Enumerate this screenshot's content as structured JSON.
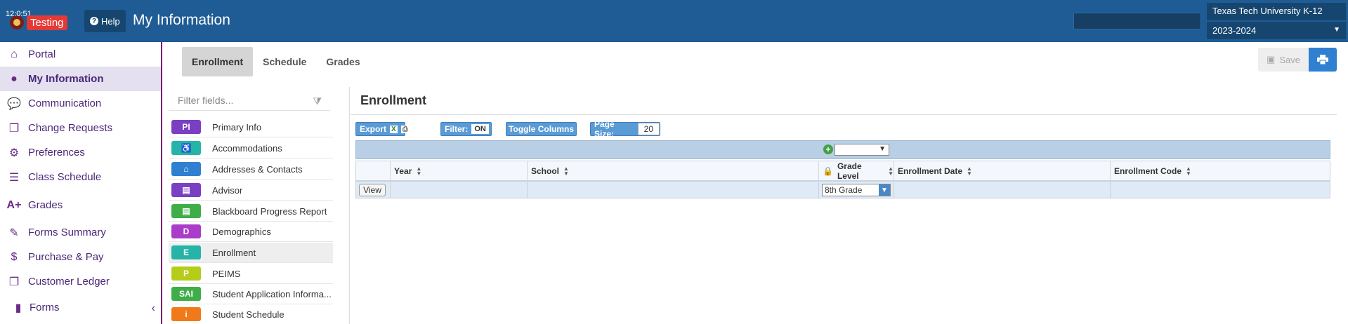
{
  "header": {
    "clock": "12:0:51",
    "testing_label": "Testing",
    "help_label": "Help",
    "title": "My Information",
    "school": "Texas Tech University K-12",
    "year": "2023-2024"
  },
  "sidebar": {
    "items": [
      {
        "label": "Portal",
        "icon": "home-icon"
      },
      {
        "label": "My Information",
        "icon": "user-icon",
        "active": true
      },
      {
        "label": "Communication",
        "icon": "chat-icon"
      },
      {
        "label": "Change Requests",
        "icon": "documents-icon"
      },
      {
        "label": "Preferences",
        "icon": "gear-icon"
      },
      {
        "label": "Class Schedule",
        "icon": "list-icon"
      },
      {
        "label": "Grades",
        "icon": "a-plus-icon"
      },
      {
        "label": "Forms Summary",
        "icon": "edit-icon"
      },
      {
        "label": "Purchase & Pay",
        "icon": "dollar-icon"
      },
      {
        "label": "Customer Ledger",
        "icon": "ledger-icon"
      },
      {
        "label": "Forms",
        "icon": "file-icon"
      }
    ]
  },
  "tabs": [
    {
      "label": "Enrollment",
      "active": true
    },
    {
      "label": "Schedule"
    },
    {
      "label": "Grades"
    }
  ],
  "actions": {
    "save_label": "Save"
  },
  "fields": {
    "filter_placeholder": "Filter fields...",
    "items": [
      {
        "badge": "PI",
        "label": "Primary Info",
        "color": "#7b3fc4"
      },
      {
        "badge": "♿",
        "label": "Accommodations",
        "color": "#26b3a8"
      },
      {
        "badge": "⌂",
        "label": "Addresses & Contacts",
        "color": "#2f80d0"
      },
      {
        "badge": "▤",
        "label": "Advisor",
        "color": "#7b3fc4"
      },
      {
        "badge": "▤",
        "label": "Blackboard Progress Report",
        "color": "#3fae49"
      },
      {
        "badge": "D",
        "label": "Demographics",
        "color": "#a93cc9"
      },
      {
        "badge": "E",
        "label": "Enrollment",
        "color": "#26b3a8",
        "active": true
      },
      {
        "badge": "P",
        "label": "PEIMS",
        "color": "#b5cc18"
      },
      {
        "badge": "SAI",
        "label": "Student Application Informa...",
        "color": "#3fae49"
      },
      {
        "badge": "i",
        "label": "Student Schedule",
        "color": "#f07a1a"
      }
    ]
  },
  "main": {
    "section_title": "Enrollment",
    "toolbar": {
      "export_label": "Export",
      "filter_label": "Filter:",
      "filter_value": "ON",
      "toggle_label": "Toggle Columns",
      "page_size_label": "Page Size:",
      "page_size_value": "20"
    },
    "columns": [
      "Year",
      "School",
      "Grade Level",
      "Enrollment Date",
      "Enrollment Code"
    ],
    "row": {
      "view_label": "View",
      "grade_level": "8th Grade"
    }
  }
}
